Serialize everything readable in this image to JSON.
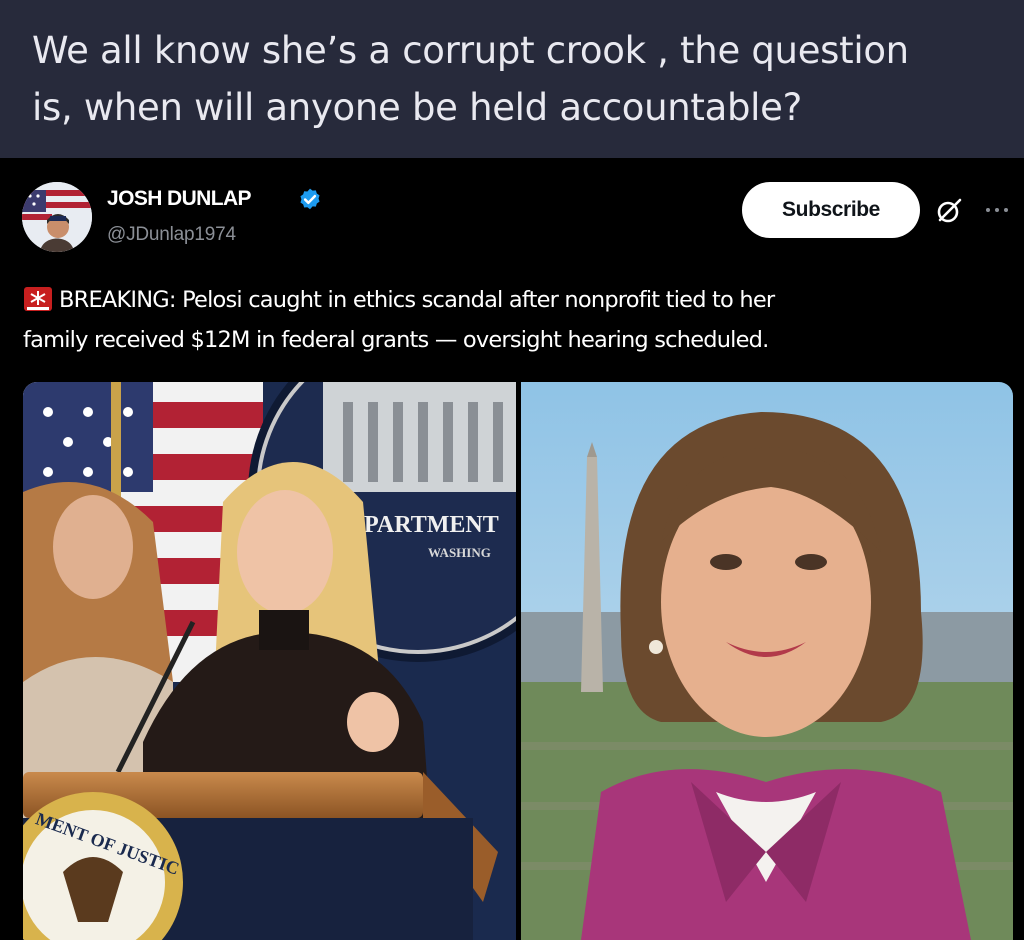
{
  "caption": {
    "line1": "We all know she’s a corrupt crook , the question",
    "line2": "is, when will anyone be held accountable?"
  },
  "post": {
    "author": {
      "name": "JOSH DUNLAP",
      "handle": "@JDunlap1974",
      "verified": true,
      "verified_color": "#1d9bf0"
    },
    "subscribe_label": "Subscribe",
    "text": {
      "line1": "BREAKING: Pelosi caught in ethics scandal after nonprofit tied to her",
      "line2": "family received $12M in federal grants — oversight hearing scheduled."
    },
    "icons": {
      "lead": "siren-emoji-icon",
      "grok": "grok-icon",
      "more": "more-icon"
    },
    "media": {
      "left": {
        "podium_seal_text": "MENT OF JUSTIC",
        "backdrop_seal_text": "EPARTMENT",
        "backdrop_seal_subtext": "WASHING"
      }
    }
  }
}
